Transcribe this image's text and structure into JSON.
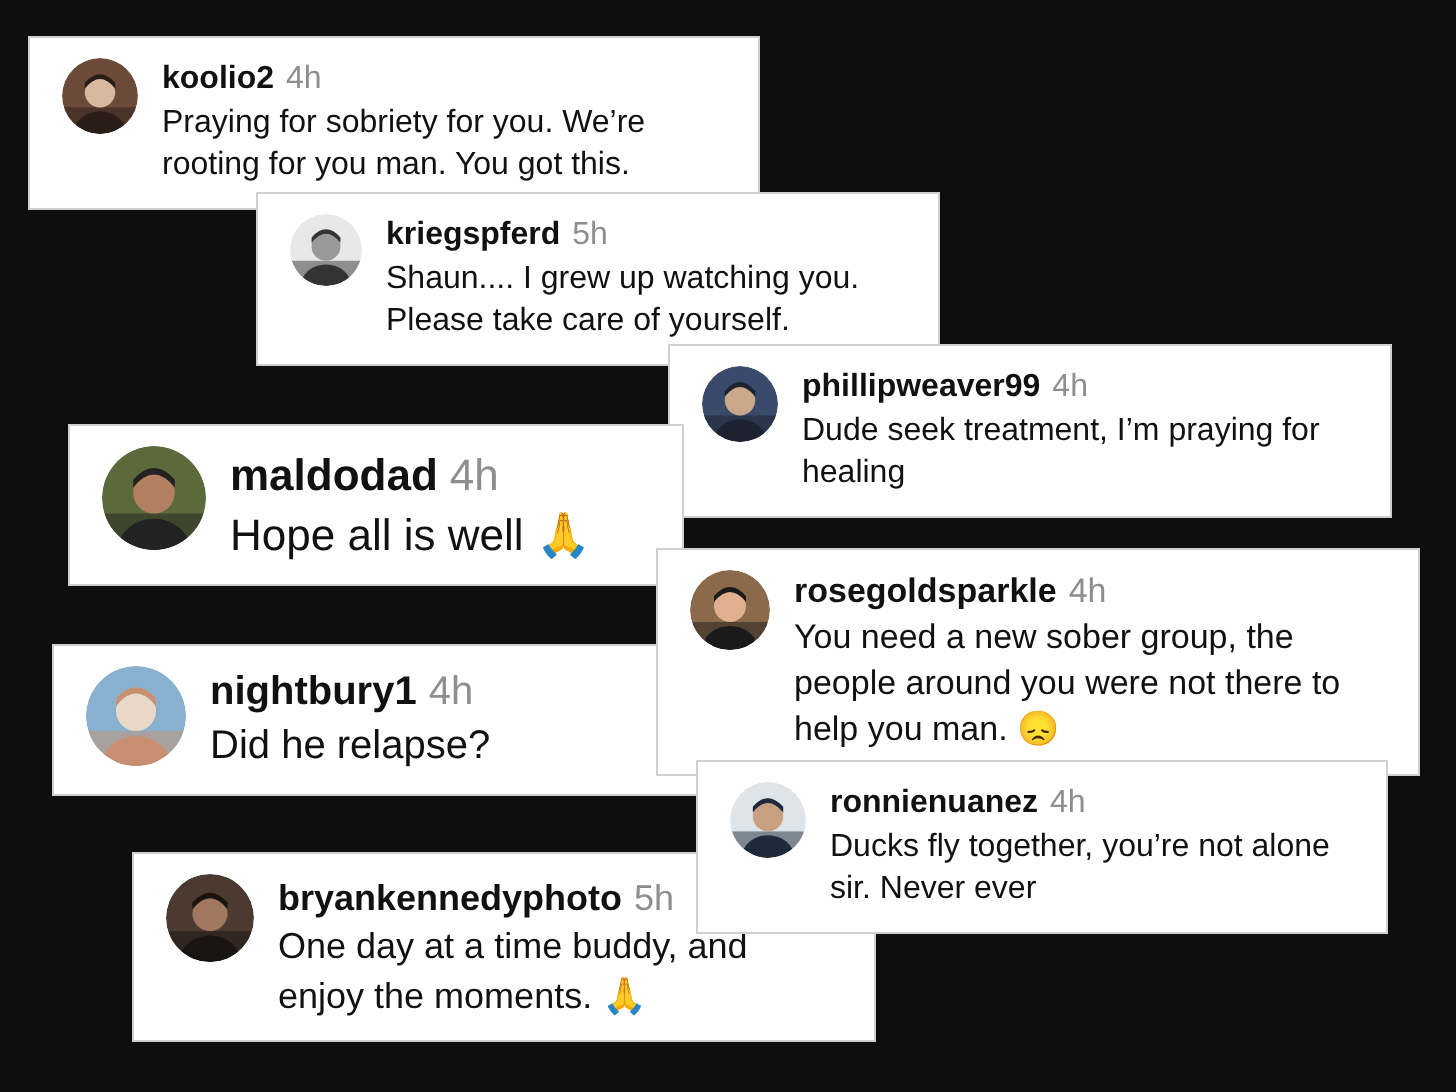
{
  "comments": [
    {
      "username": "koolio2",
      "time": "4h",
      "text": "Praying for sobriety for you. We’re rooting for you man. You got this."
    },
    {
      "username": "kriegspferd",
      "time": "5h",
      "text": "Shaun.... I grew up watching you. Please take care of yourself."
    },
    {
      "username": "phillipweaver99",
      "time": "4h",
      "text": "Dude seek treatment, I’m praying for healing"
    },
    {
      "username": "maldodad",
      "time": "4h",
      "text": "Hope all is well 🙏"
    },
    {
      "username": "rosegoldsparkle",
      "time": "4h",
      "text": "You need a new sober group, the people around you were not there to help you man. 😞"
    },
    {
      "username": "nightbury1",
      "time": "4h",
      "text": "Did he relapse?"
    },
    {
      "username": "ronnienuanez",
      "time": "4h",
      "text": "Ducks fly together, you’re not alone sir. Never ever"
    },
    {
      "username": "bryankennedyphoto",
      "time": "5h",
      "text": "One day at a time buddy, and enjoy the moments. 🙏"
    }
  ]
}
